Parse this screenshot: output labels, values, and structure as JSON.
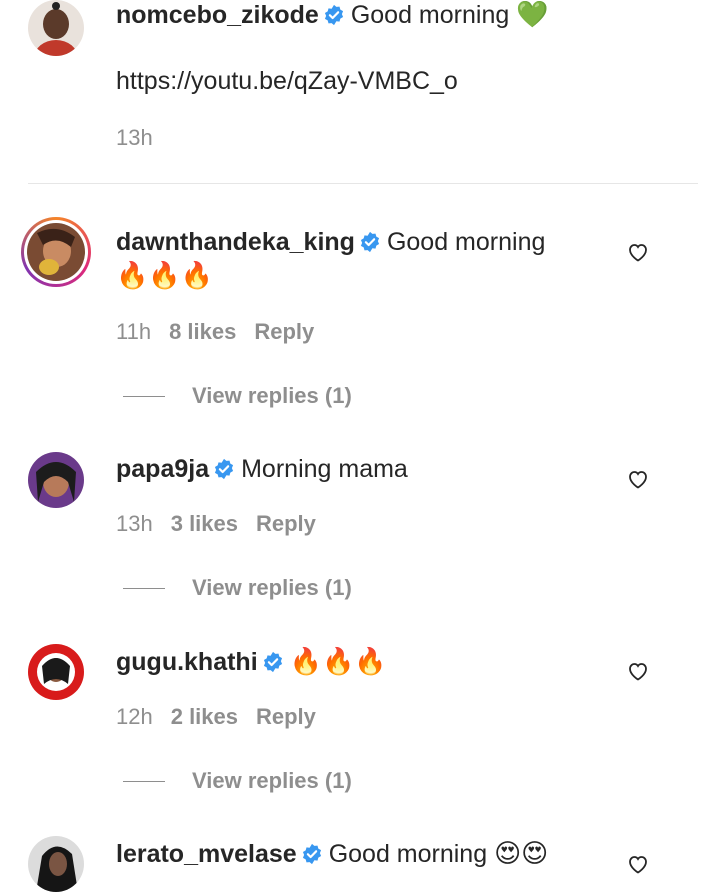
{
  "caption": {
    "username": "nomcebo_zikode",
    "text": "Good morning",
    "emoji": "💚",
    "link": "https://youtu.be/qZay-VMBC_o",
    "time": "13h"
  },
  "comments": [
    {
      "username": "dawnthandeka_king",
      "text": "Good morning",
      "emoji": "🔥🔥🔥",
      "time": "11h",
      "likes": "8 likes",
      "reply": "Reply",
      "view_replies": "View replies (1)"
    },
    {
      "username": "papa9ja",
      "text": "Morning mama",
      "time": "13h",
      "likes": "3 likes",
      "reply": "Reply",
      "view_replies": "View replies (1)"
    },
    {
      "username": "gugu.khathi",
      "emoji": "🔥🔥🔥",
      "time": "12h",
      "likes": "2 likes",
      "reply": "Reply",
      "view_replies": "View replies (1)"
    },
    {
      "username": "lerato_mvelase",
      "text": "Good morning",
      "emoji": "😍😍"
    }
  ],
  "colors": {
    "verified_blue": "#3897f0",
    "meta_gray": "#8e8e8e",
    "text": "#262626"
  },
  "icons": {
    "verified": "verified-badge-icon",
    "like": "heart-outline-icon"
  }
}
